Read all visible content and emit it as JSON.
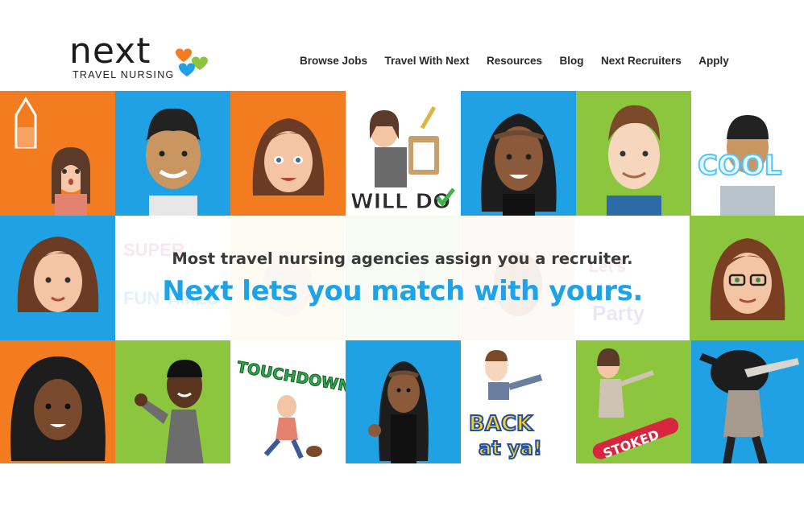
{
  "brand": {
    "name": "next",
    "tagline": "TRAVEL NURSING",
    "colors": {
      "orange": "#f47c20",
      "blue": "#1fa1e3",
      "green": "#8cc63e"
    }
  },
  "nav": {
    "items": [
      {
        "label": "Browse Jobs"
      },
      {
        "label": "Travel With Next"
      },
      {
        "label": "Resources"
      },
      {
        "label": "Blog"
      },
      {
        "label": "Next Recruiters"
      },
      {
        "label": "Apply"
      }
    ]
  },
  "hero": {
    "line1": "Most travel nursing agencies assign you a recruiter.",
    "line2": "Next lets you match with yours."
  },
  "stickers": {
    "will_do": "WILL DO",
    "cool": "COOL",
    "touchdown": "TOUCHDOWN",
    "back_at_ya": "BACK at ya!",
    "stoked": "STOKED"
  },
  "tile_colors": {
    "orange": "#f47c20",
    "blue": "#1fa1e3",
    "green": "#8cc63e",
    "white": "#ffffff"
  }
}
